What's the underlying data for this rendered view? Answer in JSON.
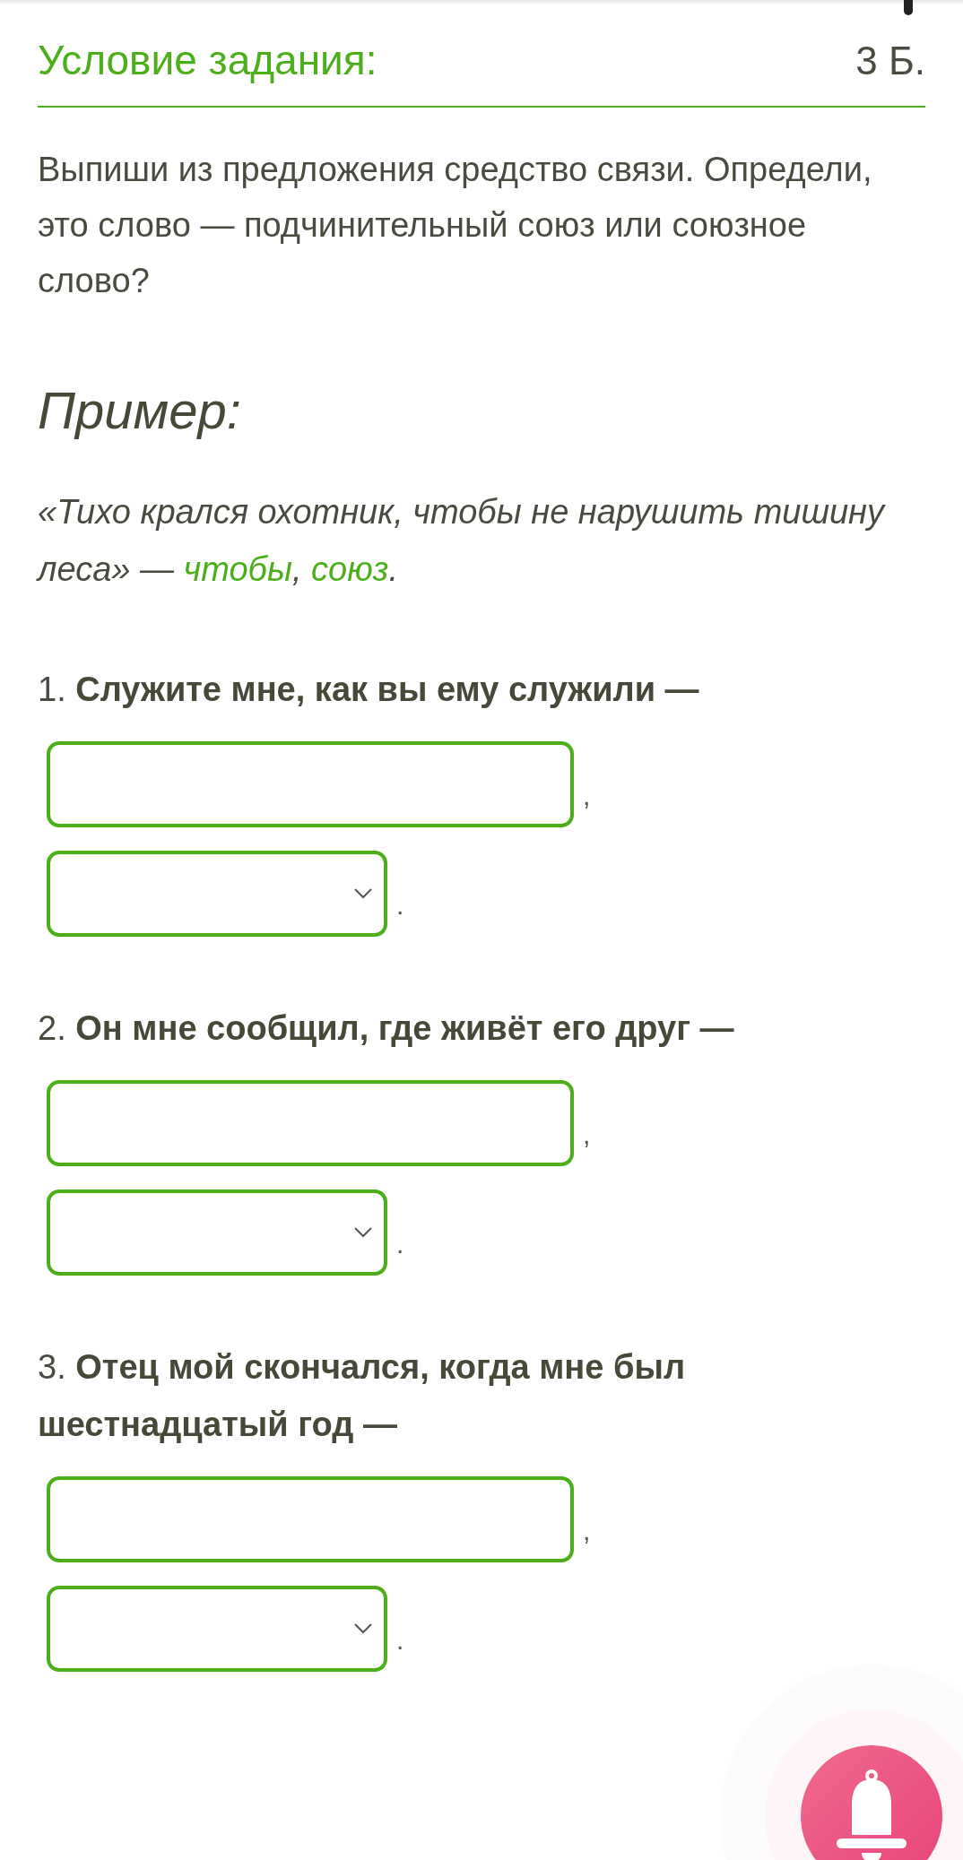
{
  "header": {
    "title": "Условие задания:",
    "points": "3 Б."
  },
  "instruction": "Выпиши из предложения средство связи. Определи, это слово — подчинительный союз или союзное слово?",
  "example": {
    "heading": "Пример:",
    "segments": [
      {
        "text": "«Тихо крался охотник, чтобы не нарушить тишину леса» — ",
        "highlight": false
      },
      {
        "text": "чтобы",
        "highlight": true
      },
      {
        "text": ", ",
        "highlight": false
      },
      {
        "text": "союз",
        "highlight": true
      },
      {
        "text": ".",
        "highlight": false
      }
    ]
  },
  "items": [
    {
      "number": "1.",
      "sentence": "Служите мне, как вы ему служили —",
      "fields": [
        {
          "kind": "text",
          "after": ","
        },
        {
          "kind": "select",
          "after": "."
        }
      ]
    },
    {
      "number": "2.",
      "sentence": "Он мне сообщил, где живёт его друг —",
      "fields": [
        {
          "kind": "text",
          "after": ","
        },
        {
          "kind": "select",
          "after": "."
        }
      ]
    },
    {
      "number": "3.",
      "sentence": "Отец мой скончался, когда мне был шестнадцатый год —",
      "fields": [
        {
          "kind": "text",
          "after": ","
        },
        {
          "kind": "select",
          "after": "."
        }
      ]
    }
  ]
}
